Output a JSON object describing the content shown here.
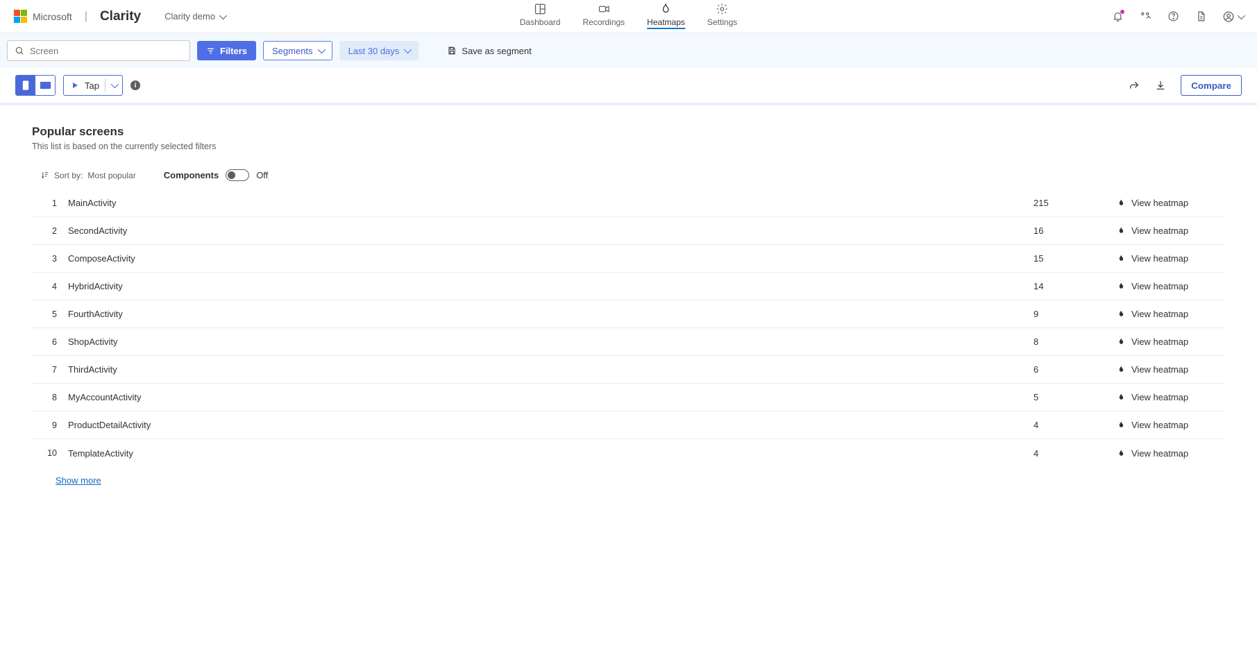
{
  "brand": {
    "ms": "Microsoft",
    "product": "Clarity"
  },
  "project": {
    "name": "Clarity demo"
  },
  "nav": {
    "dashboard": "Dashboard",
    "recordings": "Recordings",
    "heatmaps": "Heatmaps",
    "settings": "Settings"
  },
  "filters": {
    "search_placeholder": "Screen",
    "filters_label": "Filters",
    "segments_label": "Segments",
    "daterange_label": "Last 30 days",
    "save_segment_label": "Save as segment"
  },
  "toolbar": {
    "tap_label": "Tap",
    "compare_label": "Compare"
  },
  "page": {
    "title": "Popular screens",
    "subtitle": "This list is based on the currently selected filters",
    "sort_prefix": "Sort by:",
    "sort_value": "Most popular",
    "components_label": "Components",
    "components_state": "Off",
    "view_heatmap_label": "View heatmap",
    "show_more": "Show more"
  },
  "screens": [
    {
      "idx": 1,
      "name": "MainActivity",
      "count": 215
    },
    {
      "idx": 2,
      "name": "SecondActivity",
      "count": 16
    },
    {
      "idx": 3,
      "name": "ComposeActivity",
      "count": 15
    },
    {
      "idx": 4,
      "name": "HybridActivity",
      "count": 14
    },
    {
      "idx": 5,
      "name": "FourthActivity",
      "count": 9
    },
    {
      "idx": 6,
      "name": "ShopActivity",
      "count": 8
    },
    {
      "idx": 7,
      "name": "ThirdActivity",
      "count": 6
    },
    {
      "idx": 8,
      "name": "MyAccountActivity",
      "count": 5
    },
    {
      "idx": 9,
      "name": "ProductDetailActivity",
      "count": 4
    },
    {
      "idx": 10,
      "name": "TemplateActivity",
      "count": 4
    }
  ]
}
